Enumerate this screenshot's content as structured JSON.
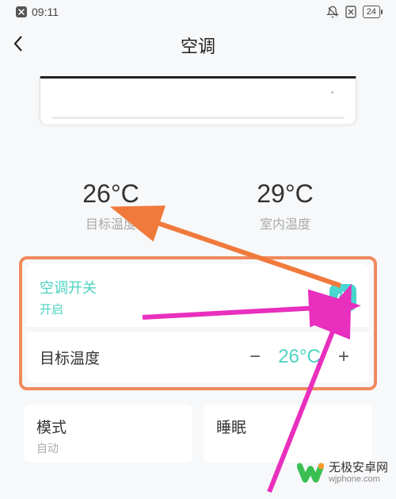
{
  "status": {
    "time": "09:11",
    "battery": "24"
  },
  "header": {
    "title": "空调"
  },
  "readouts": {
    "target_temp": "26°C",
    "target_label": "目标温度",
    "room_temp": "29°C",
    "room_label": "室内温度"
  },
  "switch_row": {
    "title": "空调开关",
    "status": "开启"
  },
  "target_row": {
    "label": "目标温度",
    "value": "26°C"
  },
  "bottom": {
    "mode_title": "模式",
    "mode_value": "自动",
    "sleep_title": "睡眠"
  },
  "watermark": {
    "line1": "无极安卓网",
    "line2": "wjphone.com"
  }
}
